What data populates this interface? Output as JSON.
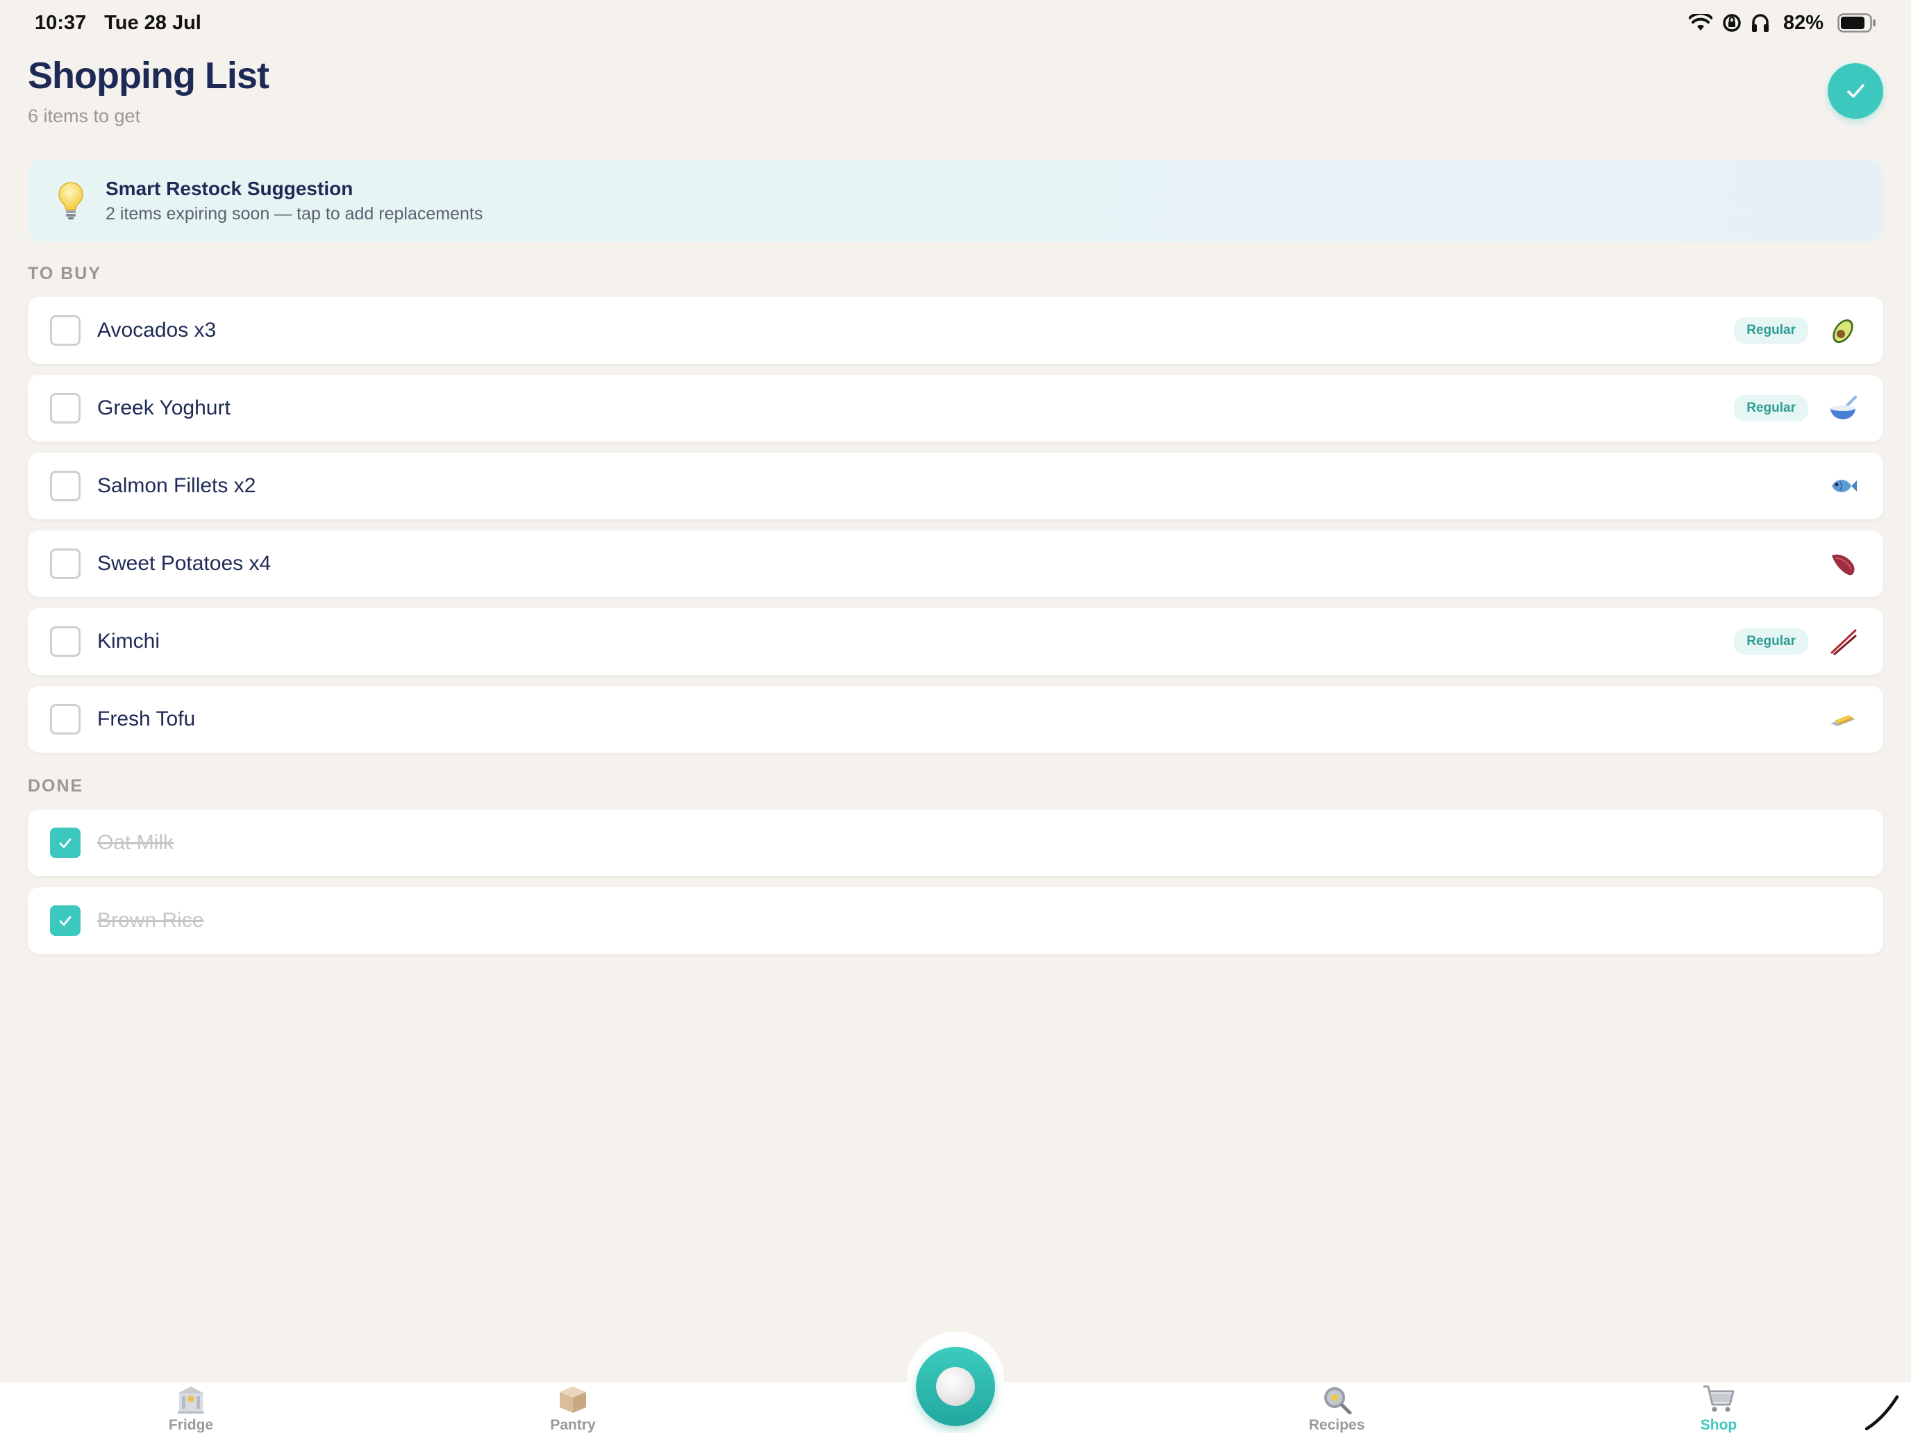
{
  "status_bar": {
    "time": "10:37",
    "date": "Tue 28 Jul",
    "battery_percent": "82%",
    "icons": [
      "wifi-icon",
      "screen-lock-icon",
      "headphones-icon",
      "battery-icon"
    ]
  },
  "header": {
    "title": "Shopping List",
    "subtitle": "6 items to get",
    "complete_icon": "checkmark-icon"
  },
  "suggestion": {
    "icon": "lightbulb-icon",
    "title": "Smart Restock Suggestion",
    "text": "2 items expiring soon — tap to add replacements"
  },
  "to_buy": {
    "label": "TO BUY",
    "items": [
      {
        "label": "Avocados x3",
        "badge": "Regular",
        "icon": "avocado-icon"
      },
      {
        "label": "Greek Yoghurt",
        "badge": "Regular",
        "icon": "bowl-icon"
      },
      {
        "label": "Salmon Fillets x2",
        "badge": "",
        "icon": "fish-icon"
      },
      {
        "label": "Sweet Potatoes x4",
        "badge": "",
        "icon": "sweet-potato-icon"
      },
      {
        "label": "Kimchi",
        "badge": "Regular",
        "icon": "chopsticks-icon"
      },
      {
        "label": "Fresh Tofu",
        "badge": "",
        "icon": "butter-icon"
      }
    ]
  },
  "done": {
    "label": "DONE",
    "items": [
      {
        "label": "Oat Milk"
      },
      {
        "label": "Brown Rice"
      }
    ]
  },
  "tab_bar": {
    "tabs": [
      {
        "label": "Fridge",
        "icon": "fridge-icon",
        "active": false
      },
      {
        "label": "Pantry",
        "icon": "package-icon",
        "active": false
      },
      {
        "label": "Recipes",
        "icon": "cooking-pan-icon",
        "active": false
      },
      {
        "label": "Shop",
        "icon": "cart-icon",
        "active": true
      }
    ],
    "center_button_icon": "record-icon"
  },
  "colors": {
    "accent": "#3cc8bf",
    "title_navy": "#1e2a55",
    "background": "#f5f2ee",
    "badge_bg": "#e6f6f4",
    "badge_text": "#2d9c94"
  }
}
